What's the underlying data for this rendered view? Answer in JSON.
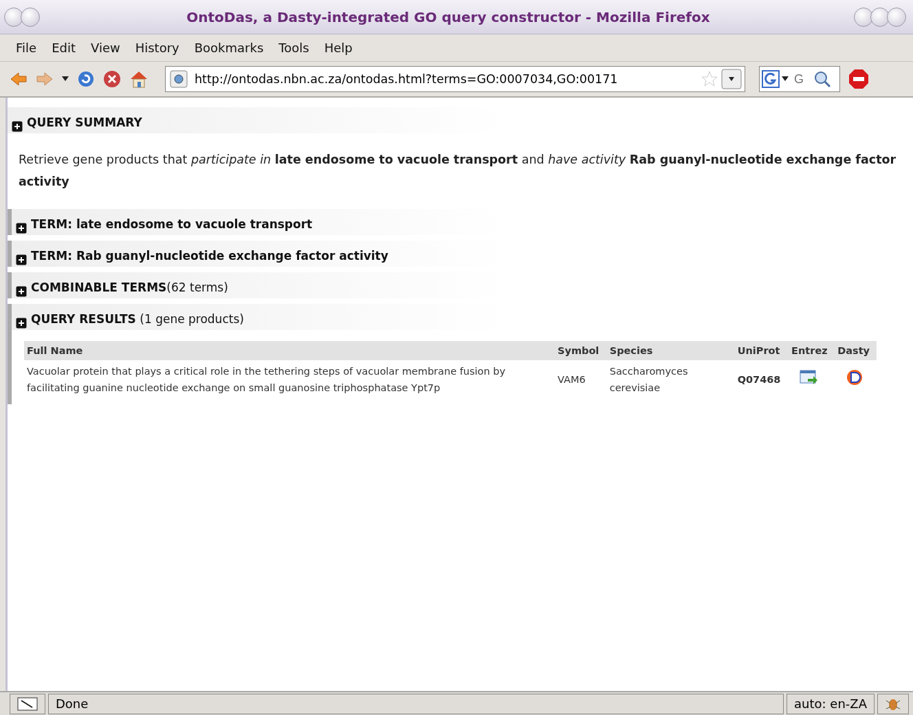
{
  "window": {
    "title": "OntoDas, a Dasty-integrated GO query constructor - Mozilla Firefox"
  },
  "menu": [
    {
      "label": "File"
    },
    {
      "label": "Edit"
    },
    {
      "label": "View"
    },
    {
      "label": "History"
    },
    {
      "label": "Bookmarks"
    },
    {
      "label": "Tools"
    },
    {
      "label": "Help"
    }
  ],
  "address_bar": {
    "value": "http://ontodas.nbn.ac.za/ontodas.html?terms=GO:0007034,GO:00171"
  },
  "search_bar": {
    "placeholder": "G"
  },
  "summary": {
    "title": "QUERY SUMMARY",
    "text": "Retrieve gene products that *participate in* **late endosome to vacuole transport** and *have activity* **Rab guanyl-nucleotide exchange factor activity**"
  },
  "sections": [
    {
      "title": "TERM: late endosome to vacuole transport"
    },
    {
      "title": "TERM: Rab guanyl-nucleotide exchange factor activity"
    },
    {
      "title": "COMBINABLE TERMS",
      "note": "(62 terms)"
    },
    {
      "title": "QUERY RESULTS",
      "note": " (1 gene products)"
    }
  ],
  "table": {
    "columns": [
      "Full Name",
      "Symbol",
      "Species",
      "UniProt",
      "Entrez",
      "Dasty"
    ],
    "rows": [
      {
        "full_name": "Vacuolar protein that plays a critical role in the tethering steps of vacuolar membrane fusion by facilitating guanine nucleotide exchange on small guanosine triphosphatase Ypt7p",
        "symbol": "VAM6",
        "species": "Saccharomyces cerevisiae",
        "uniprot": "Q07468"
      }
    ]
  },
  "status_bar": {
    "text": "Done",
    "locale": "auto: en-ZA"
  }
}
